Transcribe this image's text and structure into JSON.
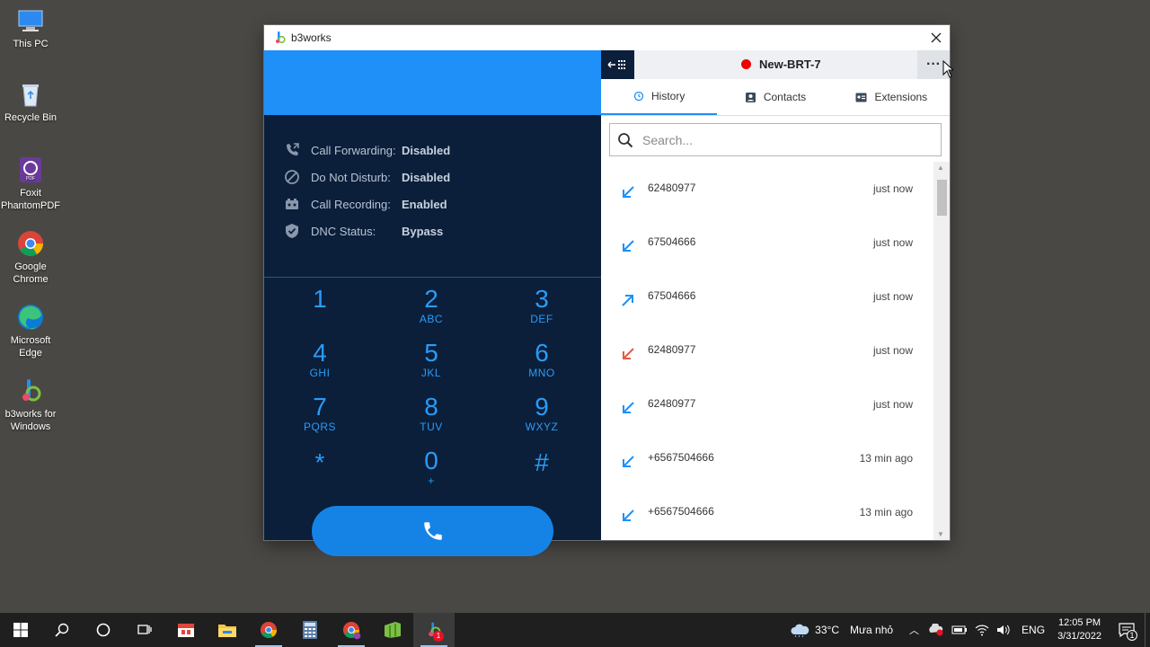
{
  "desktop": {
    "icons": [
      {
        "label": "This PC"
      },
      {
        "label": "Recycle Bin"
      },
      {
        "label": "Foxit PhantomPDF"
      },
      {
        "label": "Google Chrome"
      },
      {
        "label": "Microsoft Edge"
      },
      {
        "label": "b3works for Windows"
      }
    ]
  },
  "window": {
    "title": "b3works",
    "status": [
      {
        "label": "Call Forwarding:",
        "value": "Disabled",
        "icon": "call-forward-icon"
      },
      {
        "label": "Do Not Disturb:",
        "value": "Disabled",
        "icon": "no-entry-icon"
      },
      {
        "label": "Call Recording:",
        "value": "Enabled",
        "icon": "recording-icon"
      },
      {
        "label": "DNC Status:",
        "value": "Bypass",
        "icon": "shield-check-icon"
      }
    ],
    "dialpad": [
      {
        "digit": "1",
        "letters": ""
      },
      {
        "digit": "2",
        "letters": "ABC"
      },
      {
        "digit": "3",
        "letters": "DEF"
      },
      {
        "digit": "4",
        "letters": "GHI"
      },
      {
        "digit": "5",
        "letters": "JKL"
      },
      {
        "digit": "6",
        "letters": "MNO"
      },
      {
        "digit": "7",
        "letters": "PQRS"
      },
      {
        "digit": "8",
        "letters": "TUV"
      },
      {
        "digit": "9",
        "letters": "WXYZ"
      },
      {
        "digit": "*",
        "letters": ""
      },
      {
        "digit": "0",
        "letters": "+"
      },
      {
        "digit": "#",
        "letters": ""
      }
    ],
    "extension": {
      "name": "New-BRT-7",
      "status_color": "#e00000"
    },
    "more_label": "···",
    "tabs": [
      {
        "label": "History",
        "active": true
      },
      {
        "label": "Contacts",
        "active": false
      },
      {
        "label": "Extensions",
        "active": false
      }
    ],
    "search": {
      "placeholder": "Search..."
    },
    "history": [
      {
        "number": "62480977",
        "time": "just now",
        "direction": "incoming"
      },
      {
        "number": "67504666",
        "time": "just now",
        "direction": "incoming"
      },
      {
        "number": "67504666",
        "time": "just now",
        "direction": "outgoing"
      },
      {
        "number": "62480977",
        "time": "just now",
        "direction": "missed"
      },
      {
        "number": "62480977",
        "time": "just now",
        "direction": "incoming"
      },
      {
        "number": "+6567504666",
        "time": "13 min ago",
        "direction": "incoming"
      },
      {
        "number": "+6567504666",
        "time": "13 min ago",
        "direction": "incoming"
      }
    ],
    "colors": {
      "accent": "#1e90f7",
      "dark": "#0b1f3a",
      "incoming": "#1e90f7",
      "missed": "#e05a4a"
    }
  },
  "taskbar": {
    "weather": {
      "temp": "33°C",
      "desc": "Mưa nhỏ"
    },
    "lang": "ENG",
    "time": "12:05 PM",
    "date": "3/31/2022",
    "notification_count": "1",
    "badge_count": "1"
  }
}
